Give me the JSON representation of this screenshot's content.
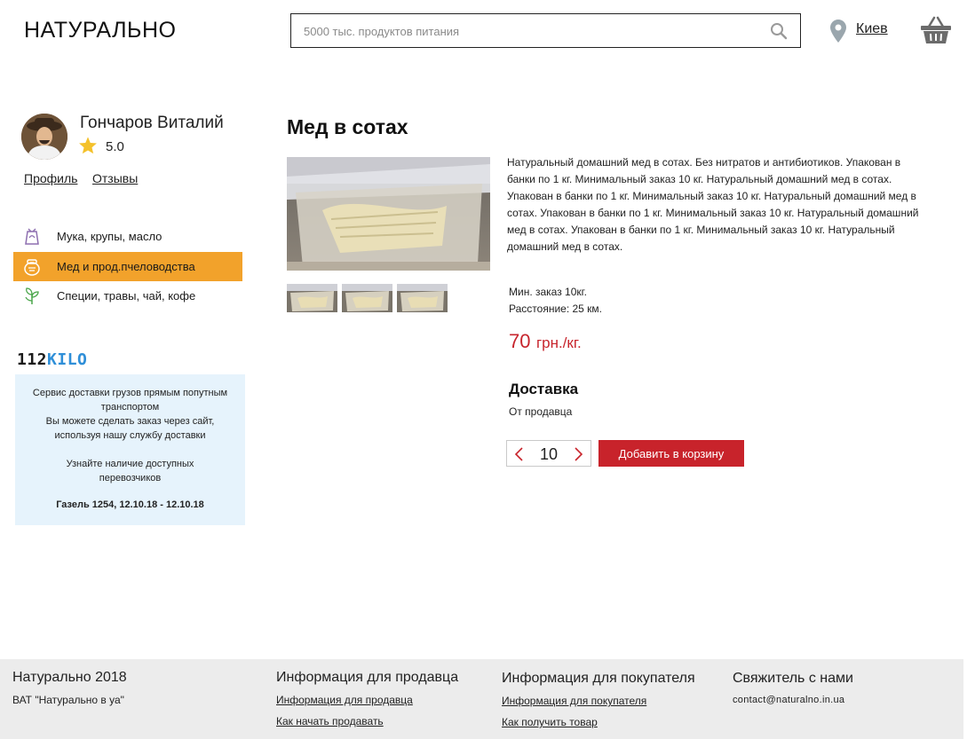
{
  "header": {
    "logo": "НАТУРАЛЬНО",
    "search_placeholder": "5000 тыс. продуктов питания",
    "search_icon": "search-icon",
    "city": "Киев",
    "location_icon": "map-pin-icon",
    "cart_icon": "basket-icon"
  },
  "seller": {
    "name": "Гончаров Виталий",
    "rating": "5.0",
    "links": {
      "profile": "Профиль",
      "reviews": "Отзывы"
    }
  },
  "categories": [
    {
      "label": "Мука, крупы, масло",
      "icon": "flour-bag-icon",
      "active": false
    },
    {
      "label": "Мед и прод.пчеловодства",
      "icon": "honey-pot-icon",
      "active": true
    },
    {
      "label": "Специи, травы, чай, кофе",
      "icon": "herbs-icon",
      "active": false
    }
  ],
  "promo": {
    "logo_num": "112",
    "logo_txt": "KILO",
    "line1": "Сервис доставки грузов прямым попутным транспортом",
    "line2": "Вы можете сделать заказ через сайт, используя нашу службу доставки",
    "line3": "Узнайте наличие доступных перевозчиков",
    "line4": "Газель 1254, 12.10.18 - 12.10.18"
  },
  "product": {
    "title": "Мед в сотах",
    "description": "Натуральный домашний мед в сотах. Без нитратов и антибиотиков. Упакован в банки по 1 кг. Минимальный заказ 10 кг. Натуральный домашний мед в сотах. Упакован в банки по 1 кг. Минимальный заказ 10 кг. Натуральный домашний мед в сотах. Упакован в банки по 1 кг. Минимальный заказ 10 кг. Натуральный домашний мед в сотах. Упакован в банки по 1 кг. Минимальный заказ 10 кг. Натуральный домашний мед в сотах.",
    "min_order": "Мин. заказ 10кг.",
    "distance": "Расстояние: 25 км.",
    "price": "70",
    "price_unit": "грн./кг.",
    "delivery_title": "Доставка",
    "delivery_from": "От продавца",
    "quantity": "10",
    "add_to_cart": "Добавить в корзину",
    "colors": {
      "price": "#c7252d",
      "button": "#c8232b",
      "active_category": "#f2a22b"
    }
  },
  "footer": {
    "col1": {
      "title": "Натурально 2018",
      "text": "ВАТ \"Натурально в уа\""
    },
    "col2": {
      "title": "Информация для продавца",
      "links": [
        "Информация для продавца",
        "Как начать продавать"
      ]
    },
    "col3": {
      "title": "Информация для покупателя",
      "links": [
        "Информация для покупателя",
        "Как получить товар"
      ]
    },
    "col4": {
      "title": "Свяжитель с нами",
      "email": "contact@naturalno.in.ua"
    }
  }
}
